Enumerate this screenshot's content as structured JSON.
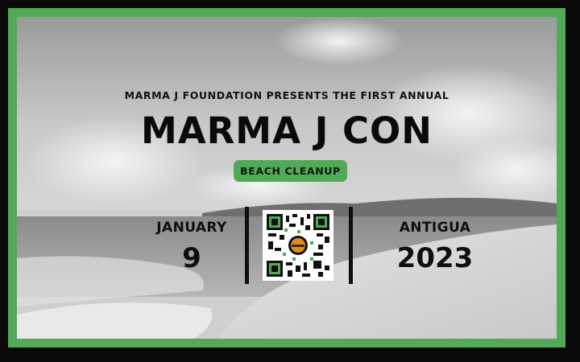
{
  "header": {
    "presents": "MARMA J FOUNDATION PRESENTS THE FIRST ANNUAL",
    "title": "MARMA J CON",
    "badge": "BEACH CLEANUP"
  },
  "date": {
    "month": "JANUARY",
    "day": "9"
  },
  "location": {
    "place": "ANTIGUA",
    "year": "2023"
  },
  "colors": {
    "accent": "#52a957",
    "text": "#0f0f0f",
    "background": "#0b0b0b"
  },
  "icons": {
    "qr": "qr-code-icon"
  }
}
